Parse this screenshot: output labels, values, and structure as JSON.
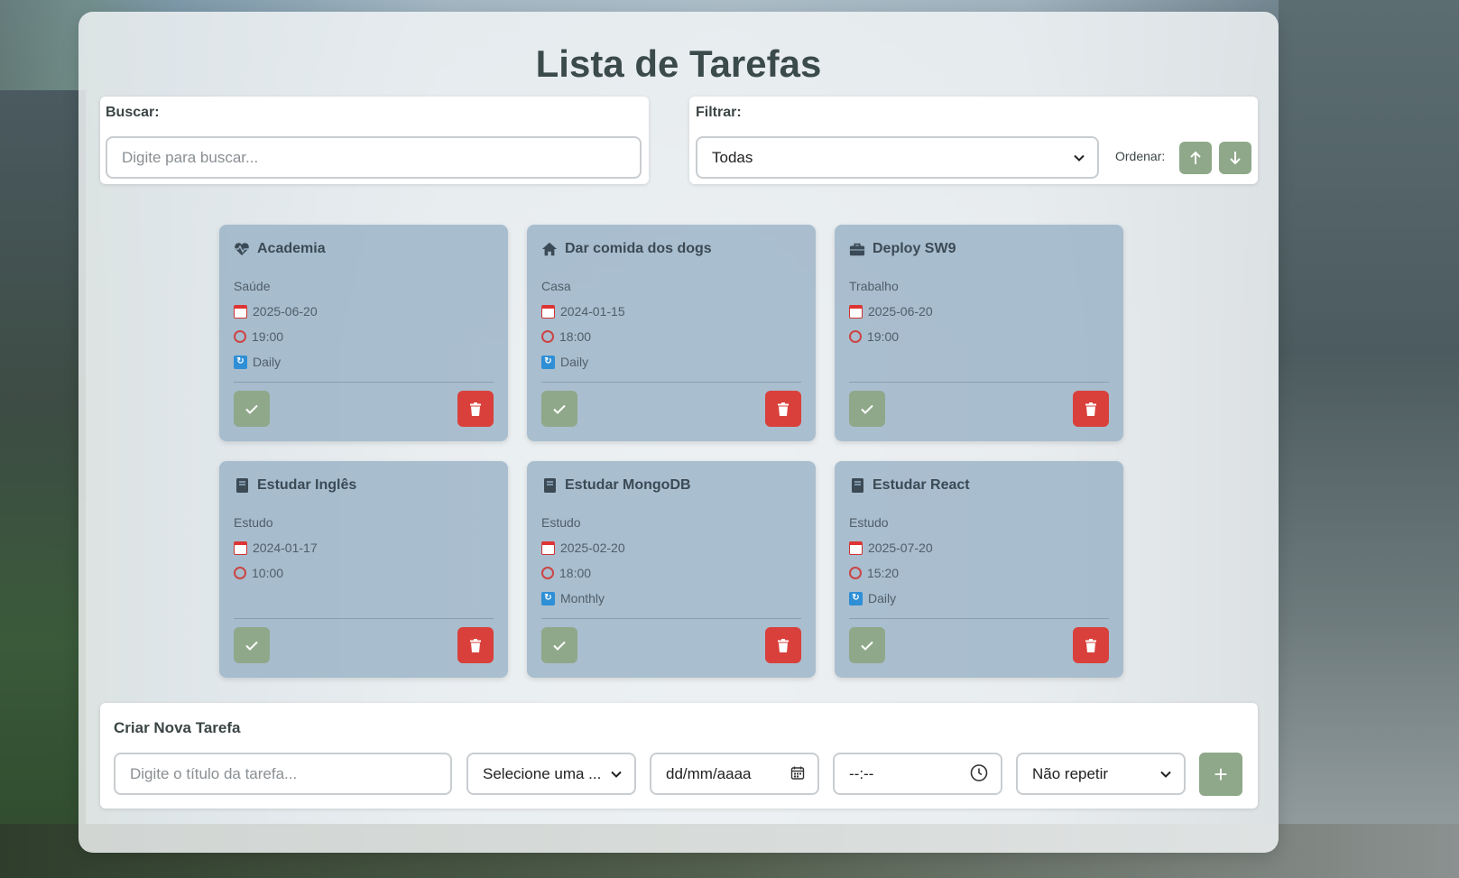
{
  "app": {
    "title": "Lista de Tarefas"
  },
  "search": {
    "label": "Buscar:",
    "placeholder": "Digite para buscar..."
  },
  "filter": {
    "label": "Filtrar:",
    "selected": "Todas",
    "sort_label": "Ordenar:"
  },
  "tasks": [
    {
      "title": "Academia",
      "icon": "heartbeat-icon",
      "category": "Saúde",
      "date": "2025-06-20",
      "time": "19:00",
      "repeat": "Daily"
    },
    {
      "title": "Dar comida dos dogs",
      "icon": "home-icon",
      "category": "Casa",
      "date": "2024-01-15",
      "time": "18:00",
      "repeat": "Daily"
    },
    {
      "title": "Deploy SW9",
      "icon": "briefcase-icon",
      "category": "Trabalho",
      "date": "2025-06-20",
      "time": "19:00",
      "repeat": ""
    },
    {
      "title": "Estudar Inglês",
      "icon": "book-icon",
      "category": "Estudo",
      "date": "2024-01-17",
      "time": "10:00",
      "repeat": ""
    },
    {
      "title": "Estudar MongoDB",
      "icon": "book-icon",
      "category": "Estudo",
      "date": "2025-02-20",
      "time": "18:00",
      "repeat": "Monthly"
    },
    {
      "title": "Estudar React",
      "icon": "book-icon",
      "category": "Estudo",
      "date": "2025-07-20",
      "time": "15:20",
      "repeat": "Daily"
    }
  ],
  "create": {
    "heading": "Criar Nova Tarefa",
    "title_placeholder": "Digite o título da tarefa...",
    "category_placeholder": "Selecione uma ...",
    "date_placeholder": "dd/mm/aaaa",
    "time_placeholder": "--:--",
    "repeat_selected": "Não repetir",
    "add_label": "+"
  },
  "colors": {
    "accent_green": "#8fa88a",
    "danger_red": "#d9403b",
    "card_bg": "#96b0c4"
  }
}
